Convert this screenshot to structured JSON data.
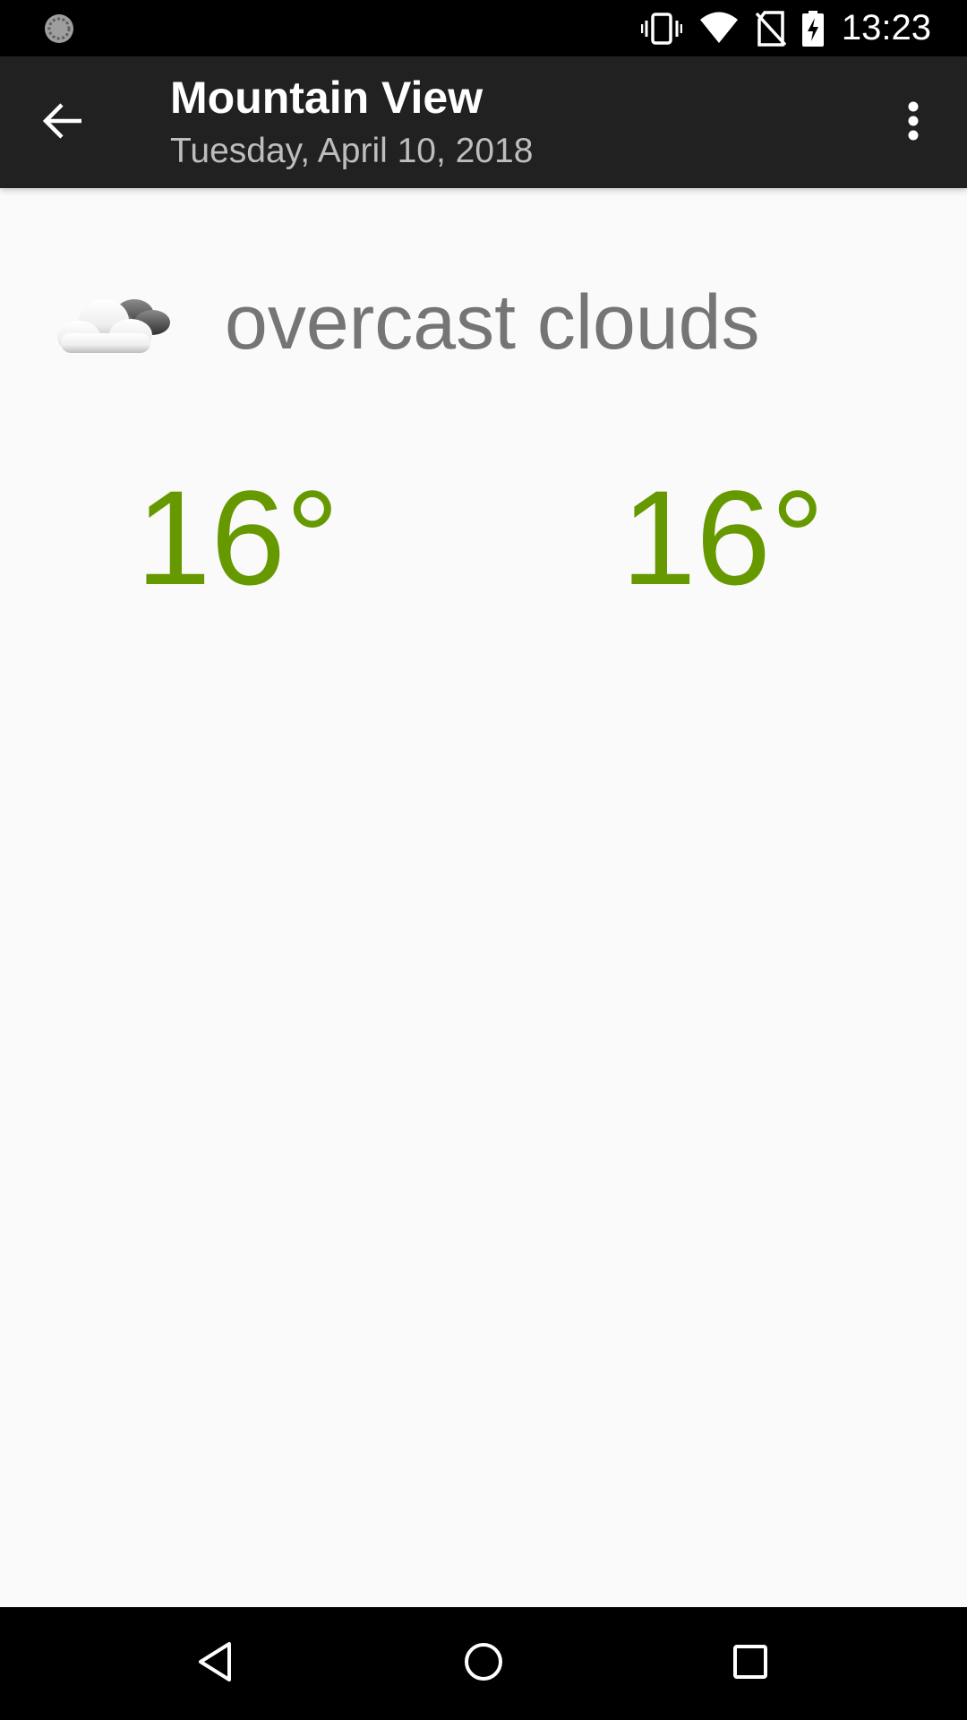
{
  "status_bar": {
    "time": "13:23",
    "icons": [
      "sync-icon",
      "vibrate-icon",
      "wifi-icon",
      "no-sim-icon",
      "battery-charging-icon"
    ]
  },
  "app_bar": {
    "title": "Mountain View",
    "subtitle": "Tuesday, April 10, 2018",
    "back_icon": "arrow-back-icon",
    "overflow_icon": "more-vert-icon"
  },
  "weather": {
    "icon": "overcast-clouds-icon",
    "description": "overcast clouds",
    "high_temp": "16°",
    "low_temp": "16°"
  },
  "colors": {
    "temperature": "#669900",
    "description": "#757575",
    "app_bar": "#212121",
    "background": "#fafafa"
  },
  "nav_bar": {
    "icons": [
      "nav-back-icon",
      "nav-home-icon",
      "nav-recents-icon"
    ]
  }
}
